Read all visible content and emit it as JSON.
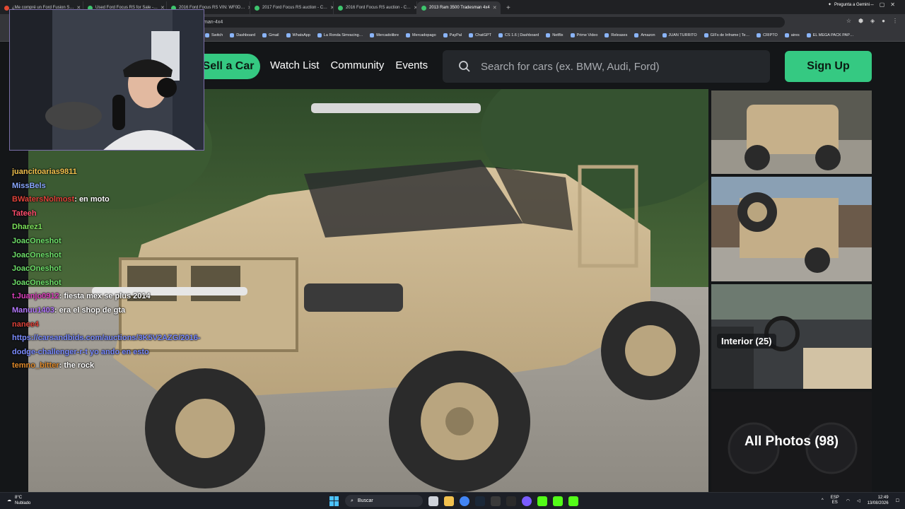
{
  "browser": {
    "tabs": [
      {
        "label": "¿Me compré un Ford Fusion S…",
        "fav": "red"
      },
      {
        "label": "Used Ford Focus RS for Sale -…",
        "fav": "green"
      },
      {
        "label": "2016 Ford Focus RS VIN: WF0D…",
        "fav": "green"
      },
      {
        "label": "2017 Ford Focus RS auction - C…",
        "fav": "green"
      },
      {
        "label": "2016 Ford Focus RS auction - C…",
        "fav": "green"
      },
      {
        "label": "2013 Ram 3500 Tradesman 4x4",
        "fav": "green"
      }
    ],
    "gemini_label": "Pregunta a Gemini",
    "url_fragment": "man-4x4",
    "bookmarks": [
      "Switch",
      "Dashboard",
      "Gmail",
      "WhatsApp",
      "La Ronda Simracing…",
      "Mercadolibre",
      "Mercadopago",
      "PayPal",
      "ChatGPT",
      "CS 1.6 | Dashboard",
      "Netflix",
      "Prime Video",
      "Releases",
      "Amazon",
      "JUAN TURRITO",
      "GIFs de Inframe | Te…",
      "CRIPTO",
      "aires",
      "EL MEGA PACK PAP…"
    ]
  },
  "site": {
    "sell_label": "Sell a Car",
    "nav": [
      "Watch List",
      "Community",
      "Events"
    ],
    "search_placeholder": "Search for cars (ex. BMW, Audi, Ford)",
    "signup_label": "Sign Up",
    "interior_badge": "Interior (25)",
    "all_photos_label": "All Photos (98)"
  },
  "chat": [
    {
      "user": "juancitoarias9811",
      "color": "#f2c14e",
      "text": ""
    },
    {
      "user": "MissBels",
      "color": "#8aa8ff",
      "text": ""
    },
    {
      "user": "BWatersNolmost",
      "color": "#e0433a",
      "text": ": en moto"
    },
    {
      "user": "Tateeh",
      "color": "#ff4d6d",
      "text": ""
    },
    {
      "user": "Dharez1",
      "color": "#7be05a",
      "text": ""
    },
    {
      "user": "JoacOneshot",
      "color": "#6ee06a",
      "text": ""
    },
    {
      "user": "JoacOneshot",
      "color": "#6ee06a",
      "text": ""
    },
    {
      "user": "JoacOneshot",
      "color": "#6ee06a",
      "text": ""
    },
    {
      "user": "JoacOneshot",
      "color": "#6ee06a",
      "text": ""
    },
    {
      "user": "t.Juanjo0912",
      "color": "#e040c0",
      "text": ": fiesta mex se plus 2014"
    },
    {
      "user": "Manuu1403",
      "color": "#b478ff",
      "text": ": era el shop de gta"
    },
    {
      "user": "nanee4",
      "color": "#e0433a",
      "text": ""
    },
    {
      "user": "",
      "color": "#7b8cff",
      "text": "https://carsandbids.com/auctions/3K5V2AZG/2016-dodge-challenger-r-t yo ando en esto"
    },
    {
      "user": "temno_bitter",
      "color": "#e08a2a",
      "text": ": the rock"
    }
  ],
  "taskbar": {
    "weather_temp": "8°C",
    "weather_desc": "Nublado",
    "search_label": "Buscar",
    "lang_top": "ESP",
    "lang_bottom": "ES",
    "time": "12:49",
    "date": "13/08/2026"
  }
}
